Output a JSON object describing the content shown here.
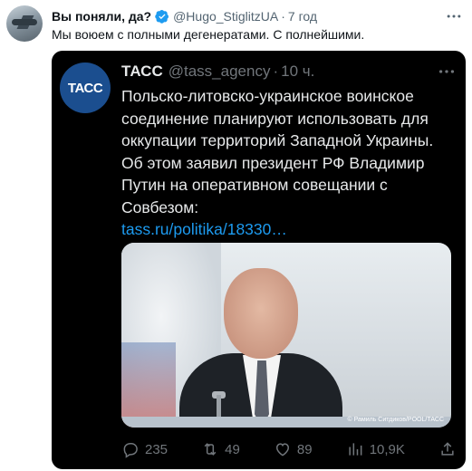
{
  "tweet": {
    "author_name": "Вы поняли, да?",
    "handle": "@Hugo_StiglitzUA",
    "separator": "·",
    "time": "7 год",
    "text": "Мы воюем с полными дегенератами. С полнейшими."
  },
  "quoted": {
    "avatar_text": "ТАСС",
    "name": "ТАСС",
    "handle": "@tass_agency",
    "separator": "·",
    "time": "10 ч.",
    "text_part1": "Польско-литов",
    "text_hl1": "ско-украинское",
    "text_part2": " воинское соединение планируют использовать для окку",
    "text_hl2": "пации",
    "text_part3": " территорий Западной ",
    "text_hl3": "Украины",
    "text_part4": ". Об этом заявил президент РФ Владимир Путин на оперативном совещании с Совбезом:",
    "link": "tass.ru/politika/18330…",
    "photo_credit": "© Рамиль Ситдиков/POOL/ТАСС",
    "highlight_color": "#d8322d"
  },
  "actions": {
    "replies": "235",
    "retweets": "49",
    "likes": "89",
    "views": "10,9K"
  },
  "colors": {
    "verified": "#1d9bf0",
    "link": "#1d9bf0",
    "quote_bg": "#000000"
  }
}
